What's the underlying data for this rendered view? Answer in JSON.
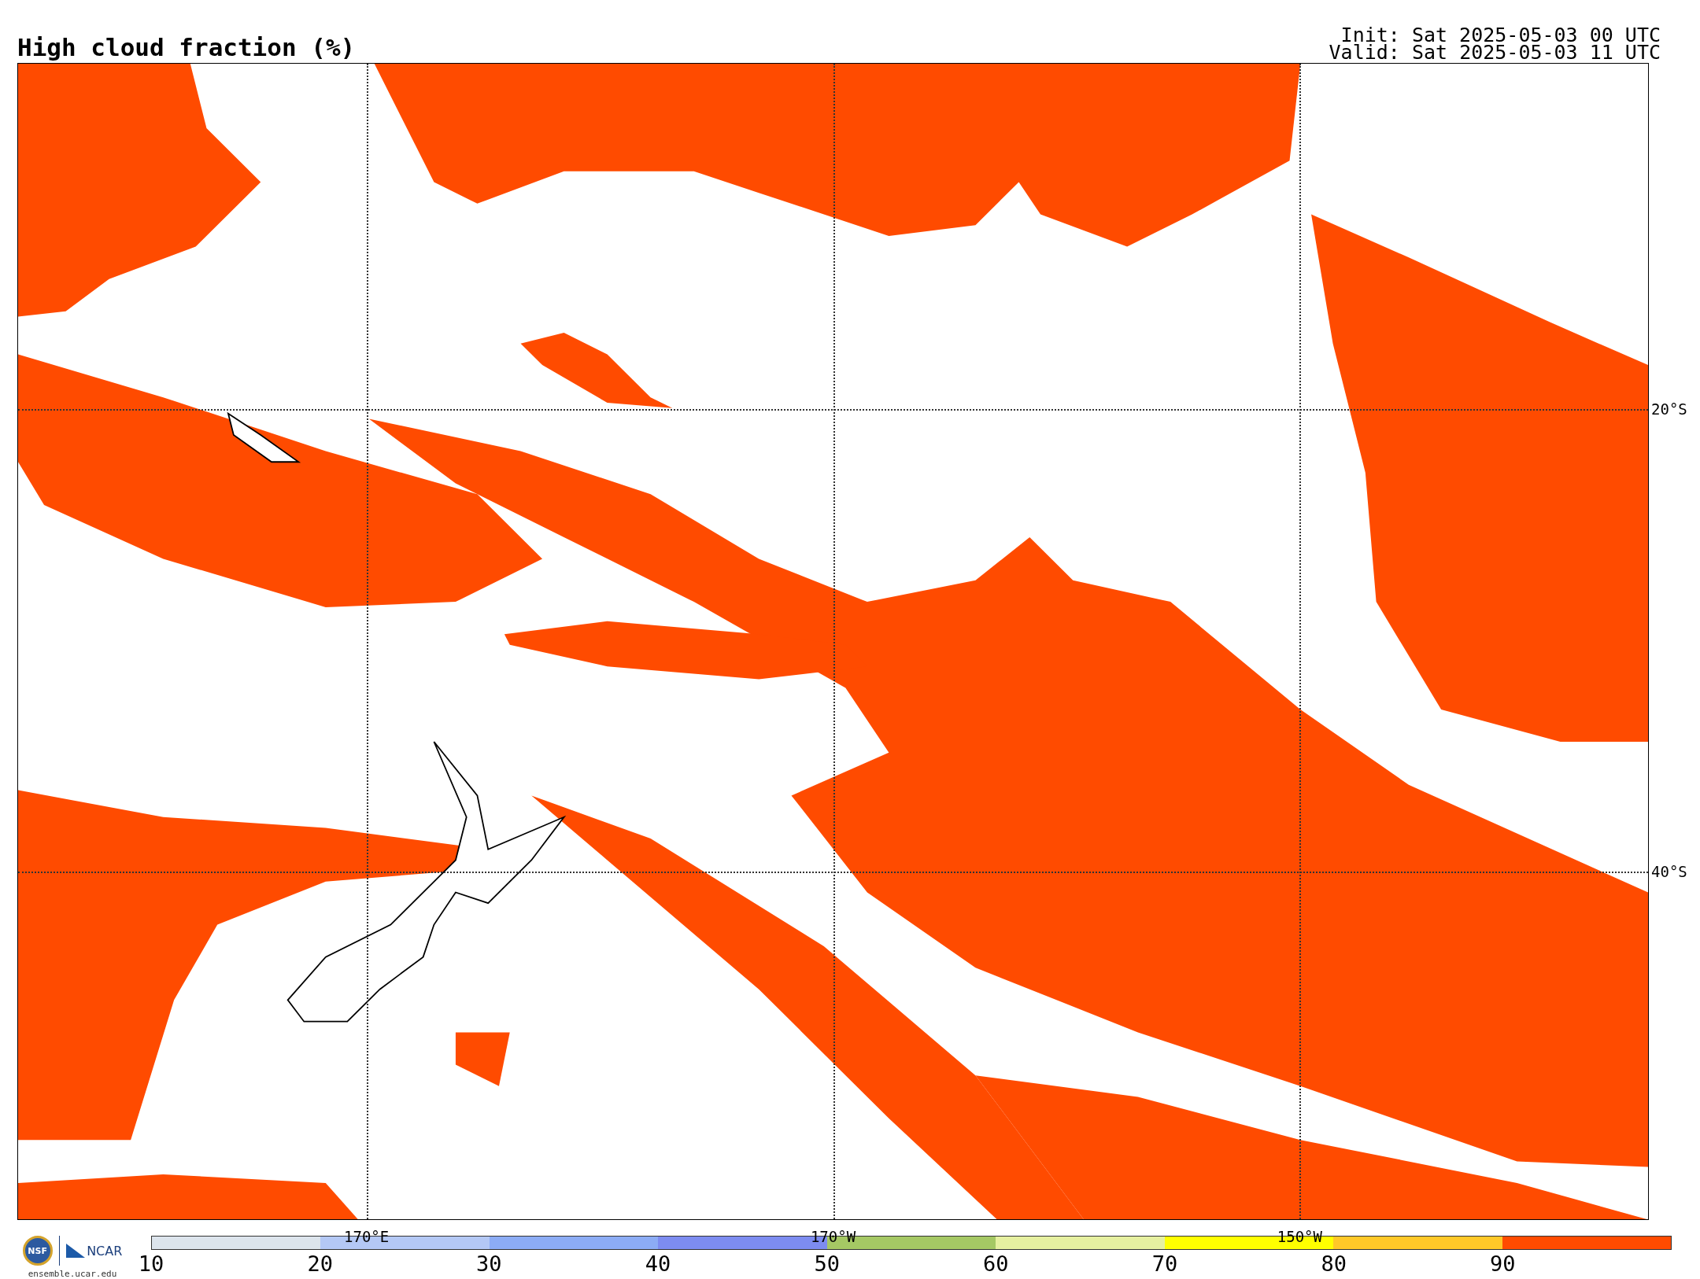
{
  "title": "High cloud fraction (%)",
  "run_info": [
    "Init: Sat 2025-05-03 00 UTC",
    "Valid: Sat 2025-05-03 11 UTC"
  ],
  "map": {
    "latitude_labels": [
      "20°S",
      "40°S"
    ],
    "longitude_labels": [
      "170°E",
      "170°W",
      "150°W"
    ]
  },
  "logos": {
    "left": "NSF",
    "right": "NCAR",
    "url": "ensemble.ucar.edu"
  },
  "colorbar": {
    "bins": [
      {
        "label": "10",
        "color": "#dce4ec"
      },
      {
        "label": "20",
        "color": "#b4c8f5"
      },
      {
        "label": "30",
        "color": "#8cacf5"
      },
      {
        "label": "40",
        "color": "#7d8cf0"
      },
      {
        "label": "50",
        "color": "#a5c864"
      },
      {
        "label": "60",
        "color": "#e6f0a0"
      },
      {
        "label": "70",
        "color": "#ffff00"
      },
      {
        "label": "80",
        "color": "#ffc828"
      },
      {
        "label": "90",
        "color": "#ff4b00"
      }
    ]
  }
}
